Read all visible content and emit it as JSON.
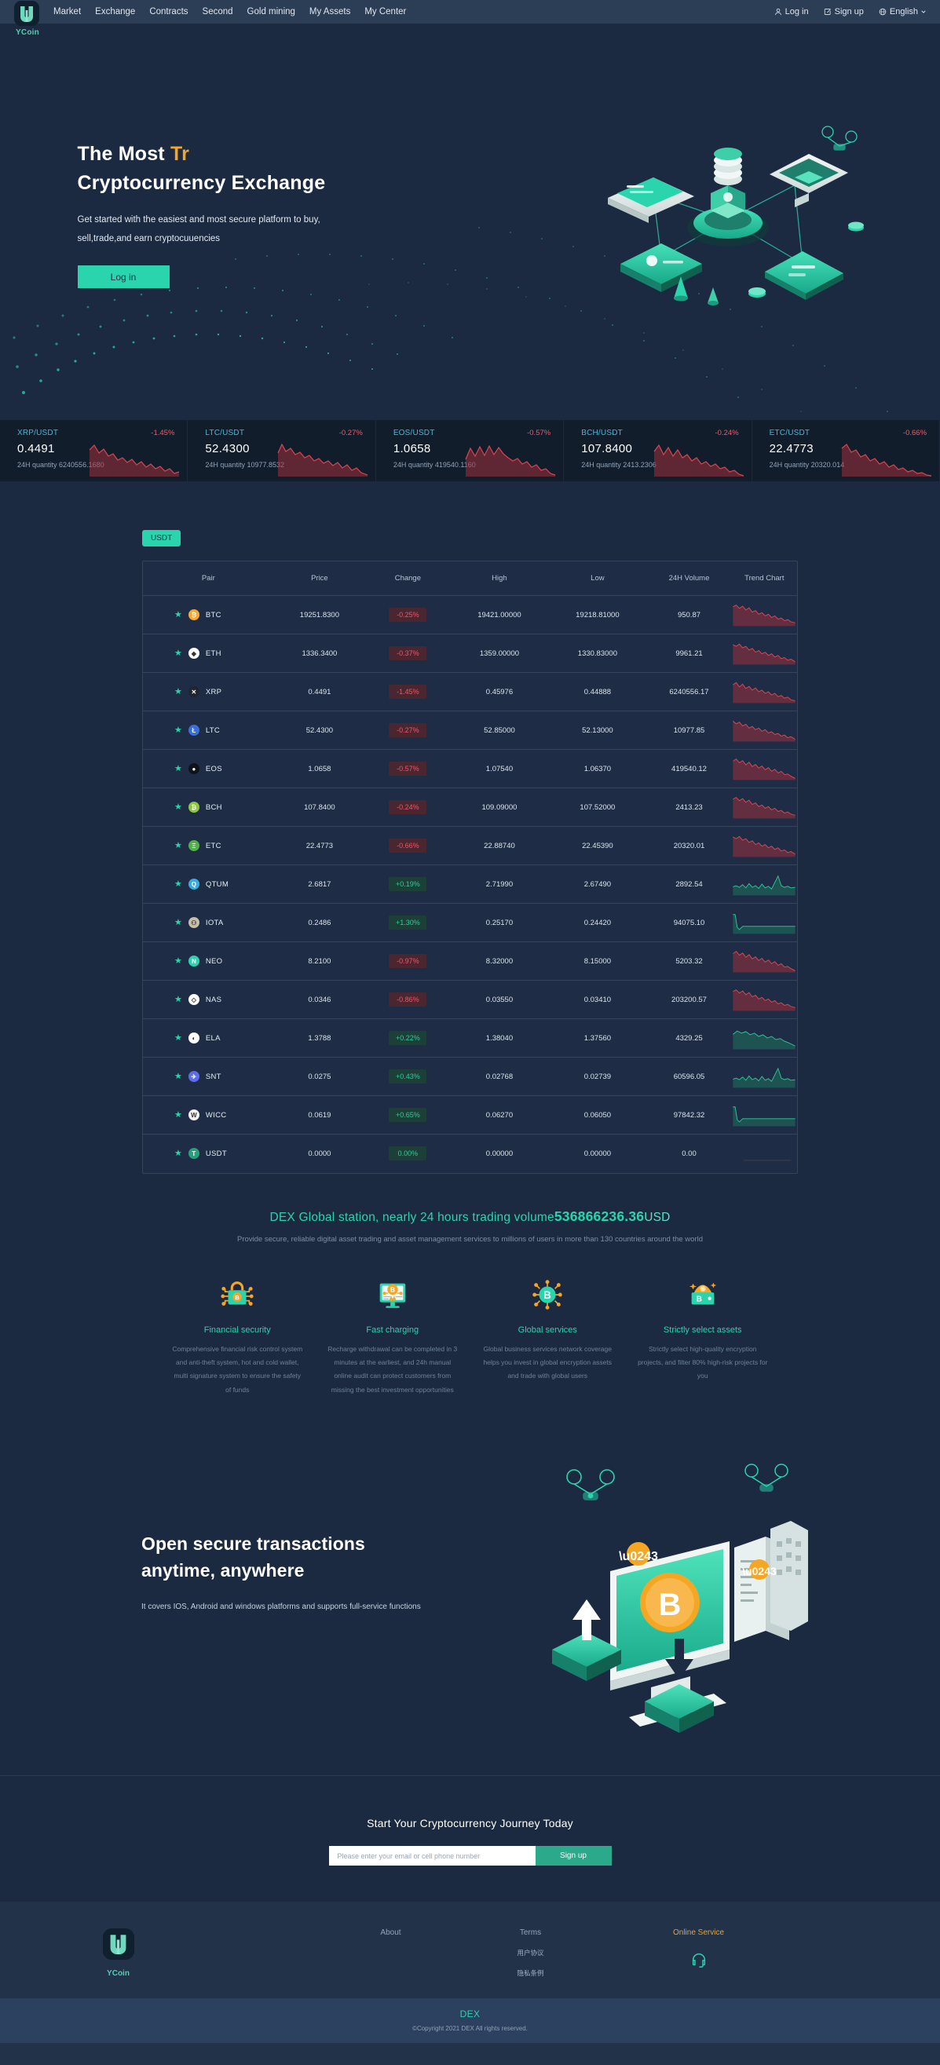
{
  "brand": {
    "name": "YCoin",
    "logo_icon": "ycoin-logo-icon"
  },
  "header": {
    "nav": [
      {
        "label": "Market"
      },
      {
        "label": "Exchange"
      },
      {
        "label": "Contracts"
      },
      {
        "label": "Second"
      },
      {
        "label": "Gold mining"
      },
      {
        "label": "My Assets"
      },
      {
        "label": "My Center"
      }
    ],
    "login_label": "Log in",
    "signup_label": "Sign up",
    "language_label": "English"
  },
  "hero": {
    "title_line1_static": "The Most",
    "title_line1_accent": "Tr",
    "title_line2": "Cryptocurrency Exchange",
    "subtitle_line1": "Get started with the easiest and most secure platform to buy,",
    "subtitle_line2": "sell,trade,and earn cryptocuuencies",
    "cta_label": "Log in"
  },
  "ticker": [
    {
      "pair": "XRP/USDT",
      "change": "-1.45%",
      "dir": "down",
      "price": "0.4491",
      "quantity": "24H quantity 6240556.1680"
    },
    {
      "pair": "LTC/USDT",
      "change": "-0.27%",
      "dir": "down",
      "price": "52.4300",
      "quantity": "24H quantity 10977.8532"
    },
    {
      "pair": "EOS/USDT",
      "change": "-0.57%",
      "dir": "down",
      "price": "1.0658",
      "quantity": "24H quantity 419540.1160"
    },
    {
      "pair": "BCH/USDT",
      "change": "-0.24%",
      "dir": "down",
      "price": "107.8400",
      "quantity": "24H quantity 2413.2306"
    },
    {
      "pair": "ETC/USDT",
      "change": "-0.66%",
      "dir": "down",
      "price": "22.4773",
      "quantity": "24H quantity 20320.014"
    }
  ],
  "market": {
    "tab_label": "USDT",
    "columns": [
      "Pair",
      "Price",
      "Change",
      "High",
      "Low",
      "24H Volume",
      "Trend Chart"
    ],
    "rows": [
      {
        "symbol": "BTC",
        "price": "19251.8300",
        "change": "-0.25%",
        "dir": "down",
        "high": "19421.00000",
        "low": "19218.81000",
        "volume": "950.87",
        "coin_color": "#f7a930",
        "coin_letter": "₿"
      },
      {
        "symbol": "ETH",
        "price": "1336.3400",
        "change": "-0.37%",
        "dir": "down",
        "high": "1359.00000",
        "low": "1330.83000",
        "volume": "9961.21",
        "coin_color": "#ffffff",
        "coin_letter": "◆"
      },
      {
        "symbol": "XRP",
        "price": "0.4491",
        "change": "-1.45%",
        "dir": "down",
        "high": "0.45976",
        "low": "0.44888",
        "volume": "6240556.17",
        "coin_color": "#20262e",
        "coin_letter": "✕"
      },
      {
        "symbol": "LTC",
        "price": "52.4300",
        "change": "-0.27%",
        "dir": "down",
        "high": "52.85000",
        "low": "52.13000",
        "volume": "10977.85",
        "coin_color": "#3a6fd8",
        "coin_letter": "Ł"
      },
      {
        "symbol": "EOS",
        "price": "1.0658",
        "change": "-0.57%",
        "dir": "down",
        "high": "1.07540",
        "low": "1.06370",
        "volume": "419540.12",
        "coin_color": "#0f1419",
        "coin_letter": "●"
      },
      {
        "symbol": "BCH",
        "price": "107.8400",
        "change": "-0.24%",
        "dir": "down",
        "high": "109.09000",
        "low": "107.52000",
        "volume": "2413.23",
        "coin_color": "#8dc63f",
        "coin_letter": "₿"
      },
      {
        "symbol": "ETC",
        "price": "22.4773",
        "change": "-0.66%",
        "dir": "down",
        "high": "22.88740",
        "low": "22.45390",
        "volume": "20320.01",
        "coin_color": "#52b048",
        "coin_letter": "Ξ"
      },
      {
        "symbol": "QTUM",
        "price": "2.6817",
        "change": "+0.19%",
        "dir": "up",
        "high": "2.71990",
        "low": "2.67490",
        "volume": "2892.54",
        "coin_color": "#3aabe0",
        "coin_letter": "Q"
      },
      {
        "symbol": "IOTA",
        "price": "0.2486",
        "change": "+1.30%",
        "dir": "up",
        "high": "0.25170",
        "low": "0.24420",
        "volume": "94075.10",
        "coin_color": "#c9bfa8",
        "coin_letter": "⚇"
      },
      {
        "symbol": "NEO",
        "price": "8.2100",
        "change": "-0.97%",
        "dir": "down",
        "high": "8.32000",
        "low": "8.15000",
        "volume": "5203.32",
        "coin_color": "#2ad4ac",
        "coin_letter": "N"
      },
      {
        "symbol": "NAS",
        "price": "0.0346",
        "change": "-0.86%",
        "dir": "down",
        "high": "0.03550",
        "low": "0.03410",
        "volume": "203200.57",
        "coin_color": "#ffffff",
        "coin_letter": "◇"
      },
      {
        "symbol": "ELA",
        "price": "1.3788",
        "change": "+0.22%",
        "dir": "up",
        "high": "1.38040",
        "low": "1.37560",
        "volume": "4329.25",
        "coin_color": "#ffffff",
        "coin_letter": "◐"
      },
      {
        "symbol": "SNT",
        "price": "0.0275",
        "change": "+0.43%",
        "dir": "up",
        "high": "0.02768",
        "low": "0.02739",
        "volume": "60596.05",
        "coin_color": "#5b6dee",
        "coin_letter": "✈"
      },
      {
        "symbol": "WICC",
        "price": "0.0619",
        "change": "+0.65%",
        "dir": "up",
        "high": "0.06270",
        "low": "0.06050",
        "volume": "97842.32",
        "coin_color": "#f2f2f2",
        "coin_letter": "W"
      },
      {
        "symbol": "USDT",
        "price": "0.0000",
        "change": "0.00%",
        "dir": "up",
        "high": "0.00000",
        "low": "0.00000",
        "volume": "0.00",
        "coin_color": "#26a17b",
        "coin_letter": "T"
      }
    ]
  },
  "stats": {
    "title_prefix": "DEX Global station, nearly 24 hours trading volume",
    "volume": "536866236.36",
    "title_suffix": "USD",
    "subtitle": "Provide secure, reliable digital asset trading and asset management services to millions of users in more than 130 countries around the world"
  },
  "features": [
    {
      "icon": "lock-bitcoin-icon",
      "title": "Financial security",
      "desc": "Comprehensive financial risk control system and anti-theft system, hot and cold wallet, multi signature system to ensure the safety of funds"
    },
    {
      "icon": "monitor-bitcoin-icon",
      "title": "Fast charging",
      "desc": "Recharge withdrawal can be completed in 3 minutes at the earliest, and 24h manual online audit can protect customers from missing the best investment opportunities"
    },
    {
      "icon": "network-bitcoin-icon",
      "title": "Global services",
      "desc": "Global business services network coverage helps you invest in global encryption assets and trade with global users"
    },
    {
      "icon": "wallet-bitcoin-icon",
      "title": "Strictly select assets",
      "desc": "Strictly select high-quality encryption projects, and filter 80% high-risk projects for you"
    }
  ],
  "promo": {
    "heading_line1": "Open secure transactions",
    "heading_line2": "anytime, anywhere",
    "paragraph": "It covers IOS, Android and windows platforms and supports full-service functions"
  },
  "cta": {
    "title": "Start Your Cryptocurrency Journey Today",
    "placeholder": "Please enter your email or cell phone number",
    "button_label": "Sign up"
  },
  "footer": {
    "brand_name": "YCoin",
    "about_title": "About",
    "terms_title": "Terms",
    "terms_links": [
      "用户协议",
      "隐私条例"
    ],
    "service_title": "Online Service",
    "copyright_title": "DEX",
    "copyright_text": "©Copyright 2021 DEX All rights reserved."
  },
  "colors": {
    "accent": "#2ad4ac",
    "orange": "#f5a623",
    "down": "#e8596b",
    "up": "#2ecc9b",
    "bg": "#1b2a41",
    "header_bg": "#2c3e56"
  }
}
